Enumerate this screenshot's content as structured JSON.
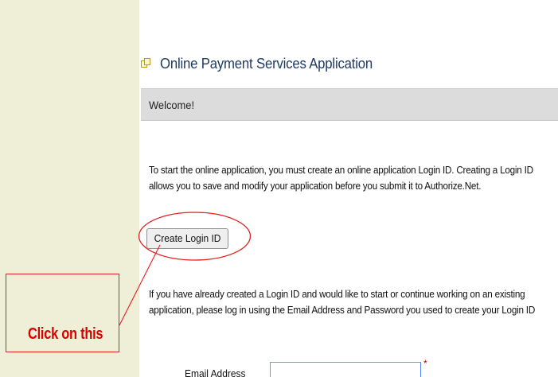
{
  "page": {
    "title": "Online Payment Services Application",
    "title_icon": "documents-icon",
    "welcome": "Welcome!",
    "intro_text_line1": "To start the online application, you must create an online application Login ID. Creating a Login ID",
    "intro_text_line2": "allows you to save and modify your application before you submit it to Authorize.Net.",
    "create_login_button": "Create Login ID",
    "existing_text_line1": "If you have already created a Login ID and would like to start or continue working on an existing",
    "existing_text_line2": "application, please log in using the Email Address and Password you used to create your Login ID",
    "email_label": "Email Address",
    "email_value": "",
    "required_marker": "*"
  },
  "annotation": {
    "callout_text": "Click on this",
    "color": "#d80000"
  },
  "colors": {
    "sidebar": "#efefd8",
    "title": "#203a62",
    "welcome_bar": "#dcdcdc",
    "annotation_red": "#e02020"
  }
}
